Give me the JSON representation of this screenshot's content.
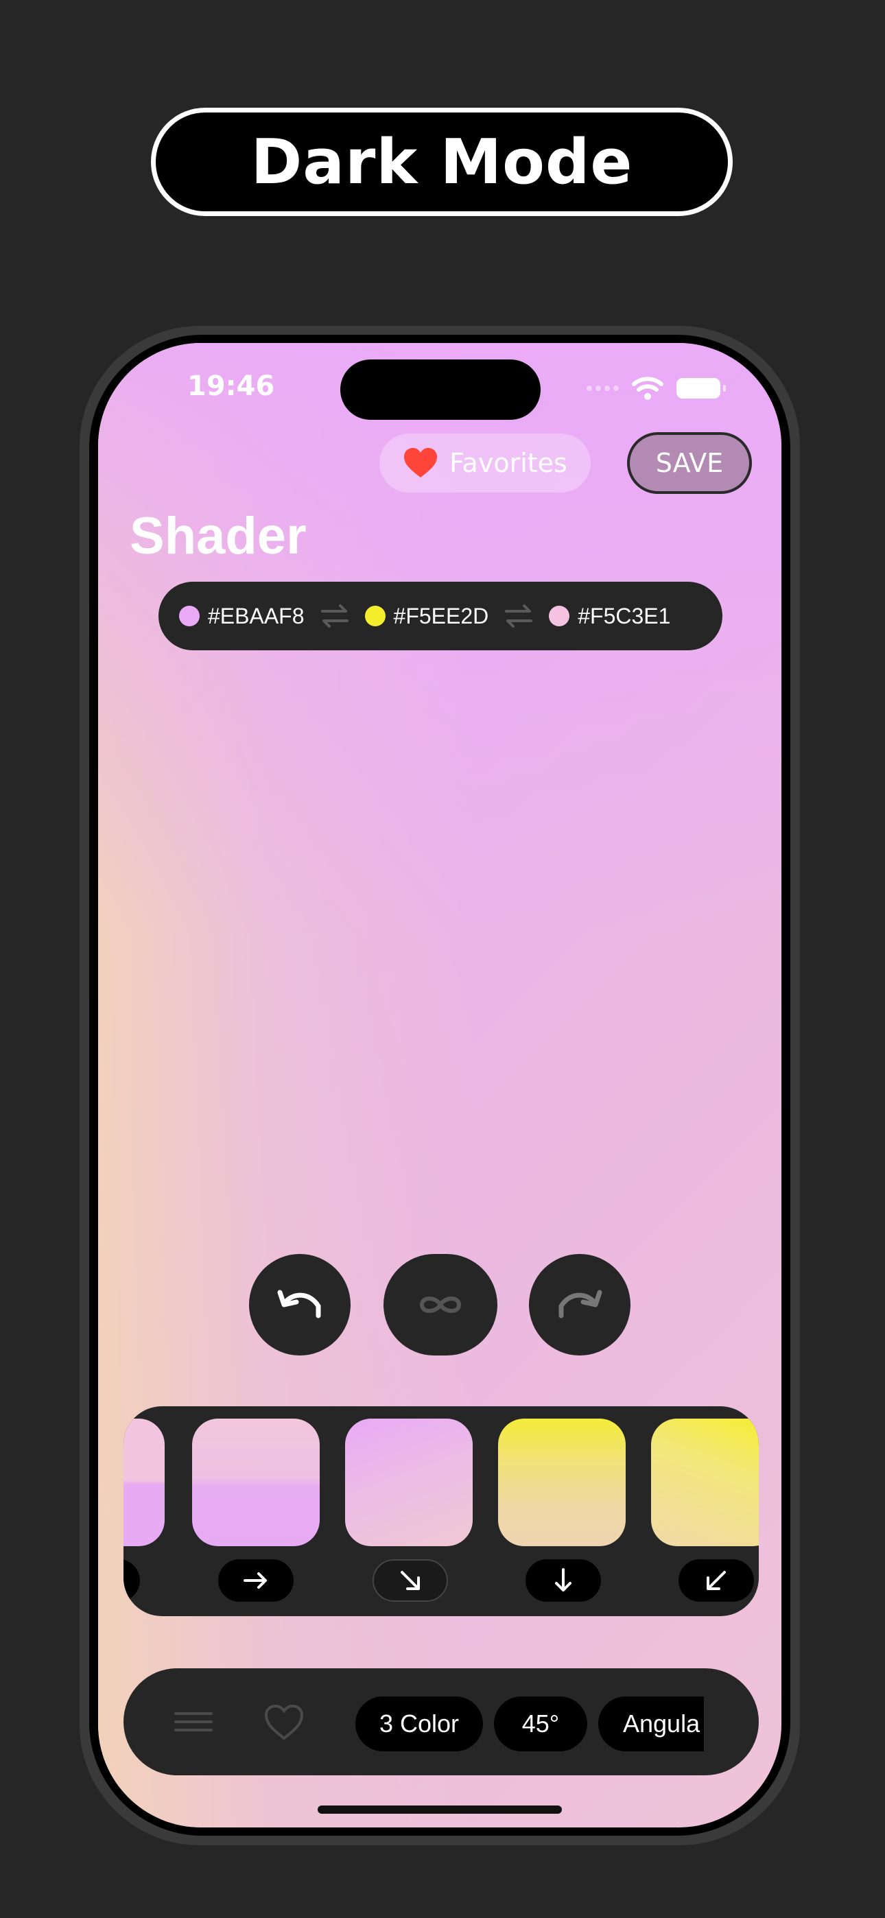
{
  "banner": {
    "title": "Dark Mode"
  },
  "status_bar": {
    "time": "19:46"
  },
  "header": {
    "favorites_label": "Favorites",
    "save_label": "SAVE",
    "title": "Shader"
  },
  "colors": [
    {
      "hex": "#EBAAF8",
      "label": "#EBAAF8"
    },
    {
      "hex": "#F5EE2D",
      "label": "#F5EE2D"
    },
    {
      "hex": "#F5C3E1",
      "label": "#F5C3E1"
    }
  ],
  "controls": {
    "undo_icon": "undo-arrow",
    "loop_icon": "infinity",
    "redo_icon": "redo-arrow"
  },
  "presets": [
    {
      "direction": "left",
      "selected": false
    },
    {
      "direction": "right",
      "selected": false
    },
    {
      "direction": "down-right",
      "selected": true
    },
    {
      "direction": "down",
      "selected": false
    },
    {
      "direction": "down-left",
      "selected": false
    }
  ],
  "toolbar": {
    "menu_icon": "menu-lines",
    "heart_icon": "heart-outline",
    "color_count": "3 Color",
    "angle": "45°",
    "mode": "Angula"
  },
  "accent": {
    "heart": "#ff453a",
    "save_bg": "#b38ab3",
    "panel_bg": "#262626"
  }
}
